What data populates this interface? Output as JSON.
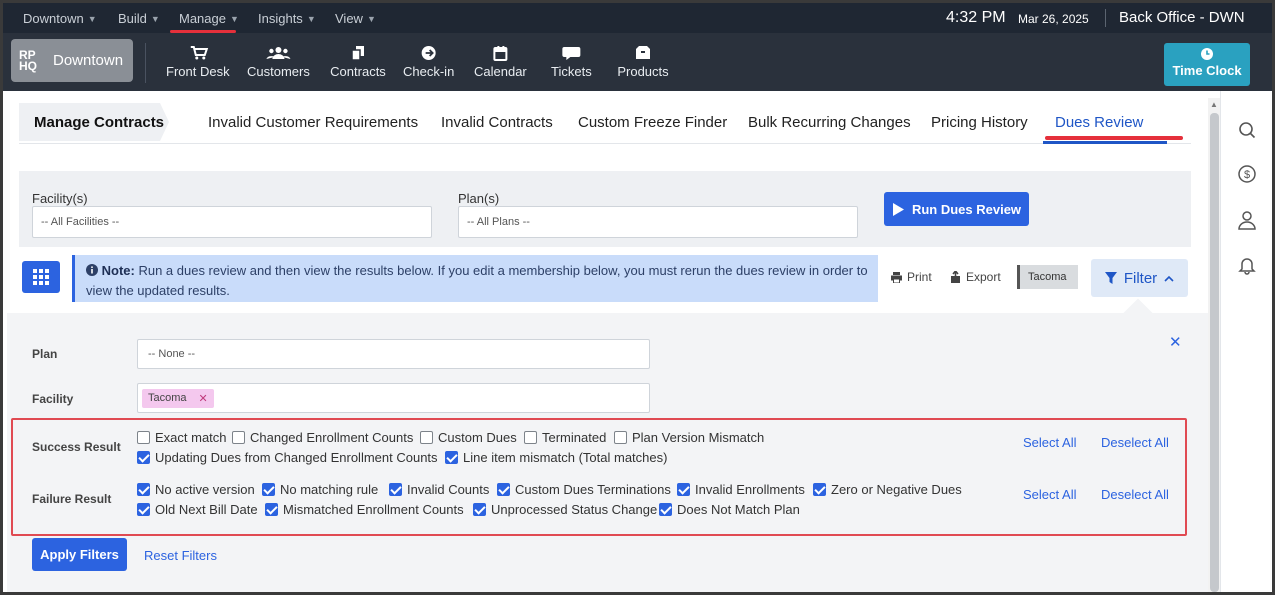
{
  "top_menu": {
    "items": [
      {
        "label": "Downtown"
      },
      {
        "label": "Build"
      },
      {
        "label": "Manage"
      },
      {
        "label": "Insights"
      },
      {
        "label": "View"
      }
    ],
    "time": "4:32 PM",
    "date": "Mar 26, 2025",
    "office": "Back Office - DWN"
  },
  "nav": {
    "logo_mark": "RP HQ",
    "logo_text": "Downtown",
    "items": [
      {
        "label": "Front Desk",
        "icon": "cart-icon"
      },
      {
        "label": "Customers",
        "icon": "users-icon"
      },
      {
        "label": "Contracts",
        "icon": "contracts-icon"
      },
      {
        "label": "Check-in",
        "icon": "arrow-circle-icon"
      },
      {
        "label": "Calendar",
        "icon": "calendar-icon"
      },
      {
        "label": "Tickets",
        "icon": "chat-icon"
      },
      {
        "label": "Products",
        "icon": "box-icon"
      }
    ],
    "time_clock": "Time Clock"
  },
  "tabs": {
    "active": "Manage Contracts",
    "items": [
      "Invalid Customer Requirements",
      "Invalid Contracts",
      "Custom Freeze Finder",
      "Bulk Recurring Changes",
      "Pricing History",
      "Dues Review"
    ]
  },
  "form": {
    "facility_label": "Facility(s)",
    "facility_value": "-- All Facilities --",
    "plan_label": "Plan(s)",
    "plan_value": "-- All Plans --",
    "run_button": "Run Dues Review"
  },
  "note": {
    "bold": "Note:",
    "text": " Run a dues review and then view the results below. If you edit a membership below, you must rerun the dues review in order to view the updated results."
  },
  "actions": {
    "print": "Print",
    "export": "Export",
    "facility_chip": "Tacoma",
    "filter": "Filter"
  },
  "filter_panel": {
    "plan_label": "Plan",
    "plan_value": "-- None --",
    "facility_label": "Facility",
    "facility_tag": "Tacoma",
    "success_label": "Success Result",
    "success_options": [
      {
        "label": "Exact match",
        "checked": false
      },
      {
        "label": "Changed Enrollment Counts",
        "checked": false
      },
      {
        "label": "Custom Dues",
        "checked": false
      },
      {
        "label": "Terminated",
        "checked": false
      },
      {
        "label": "Plan Version Mismatch",
        "checked": false
      },
      {
        "label": "Updating Dues from Changed Enrollment Counts",
        "checked": true
      },
      {
        "label": "Line item mismatch (Total matches)",
        "checked": true
      }
    ],
    "failure_label": "Failure Result",
    "failure_options": [
      {
        "label": "No active version",
        "checked": true
      },
      {
        "label": "No matching rule",
        "checked": true
      },
      {
        "label": "Invalid Counts",
        "checked": true
      },
      {
        "label": "Custom Dues Terminations",
        "checked": true
      },
      {
        "label": "Invalid Enrollments",
        "checked": true
      },
      {
        "label": "Zero or Negative Dues",
        "checked": true
      },
      {
        "label": "Old Next Bill Date",
        "checked": true
      },
      {
        "label": "Mismatched Enrollment Counts",
        "checked": true
      },
      {
        "label": "Unprocessed Status Change",
        "checked": true
      },
      {
        "label": "Does Not Match Plan",
        "checked": true
      }
    ],
    "select_all": "Select All",
    "deselect_all": "Deselect All",
    "apply": "Apply Filters",
    "reset": "Reset Filters"
  },
  "colors": {
    "accent": "#2c63e0",
    "highlight": "#e5303b",
    "topbar": "#1f2733",
    "navbar": "#2a313c",
    "time_clock": "#2aa1c0"
  }
}
